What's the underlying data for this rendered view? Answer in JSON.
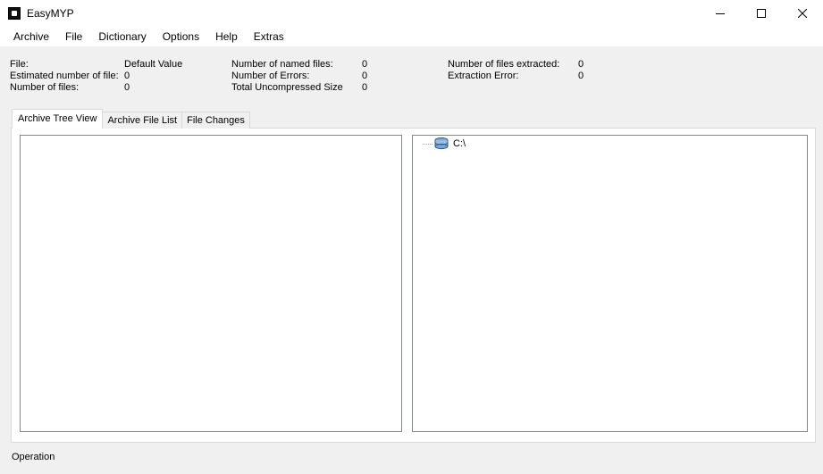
{
  "window": {
    "title": "EasyMYP"
  },
  "menu": [
    "Archive",
    "File",
    "Dictionary",
    "Options",
    "Help",
    "Extras"
  ],
  "info": {
    "file_label": "File:",
    "file_value": "Default Value",
    "estimated_label": "Estimated number of file:",
    "estimated_value": "0",
    "numfiles_label": "Number of files:",
    "numfiles_value": "0",
    "named_label": "Number of named files:",
    "named_value": "0",
    "errors_label": "Number of Errors:",
    "errors_value": "0",
    "uncompressed_label": "Total Uncompressed Size",
    "uncompressed_value": "0",
    "extracted_label": "Number of files extracted:",
    "extracted_value": "0",
    "extraction_error_label": "Extraction Error:",
    "extraction_error_value": "0"
  },
  "tabs": [
    "Archive Tree View",
    "Archive File List",
    "File Changes"
  ],
  "tree": {
    "root_label": "C:\\",
    "root_icon": "drive-icon"
  },
  "status": {
    "text": "Operation"
  }
}
